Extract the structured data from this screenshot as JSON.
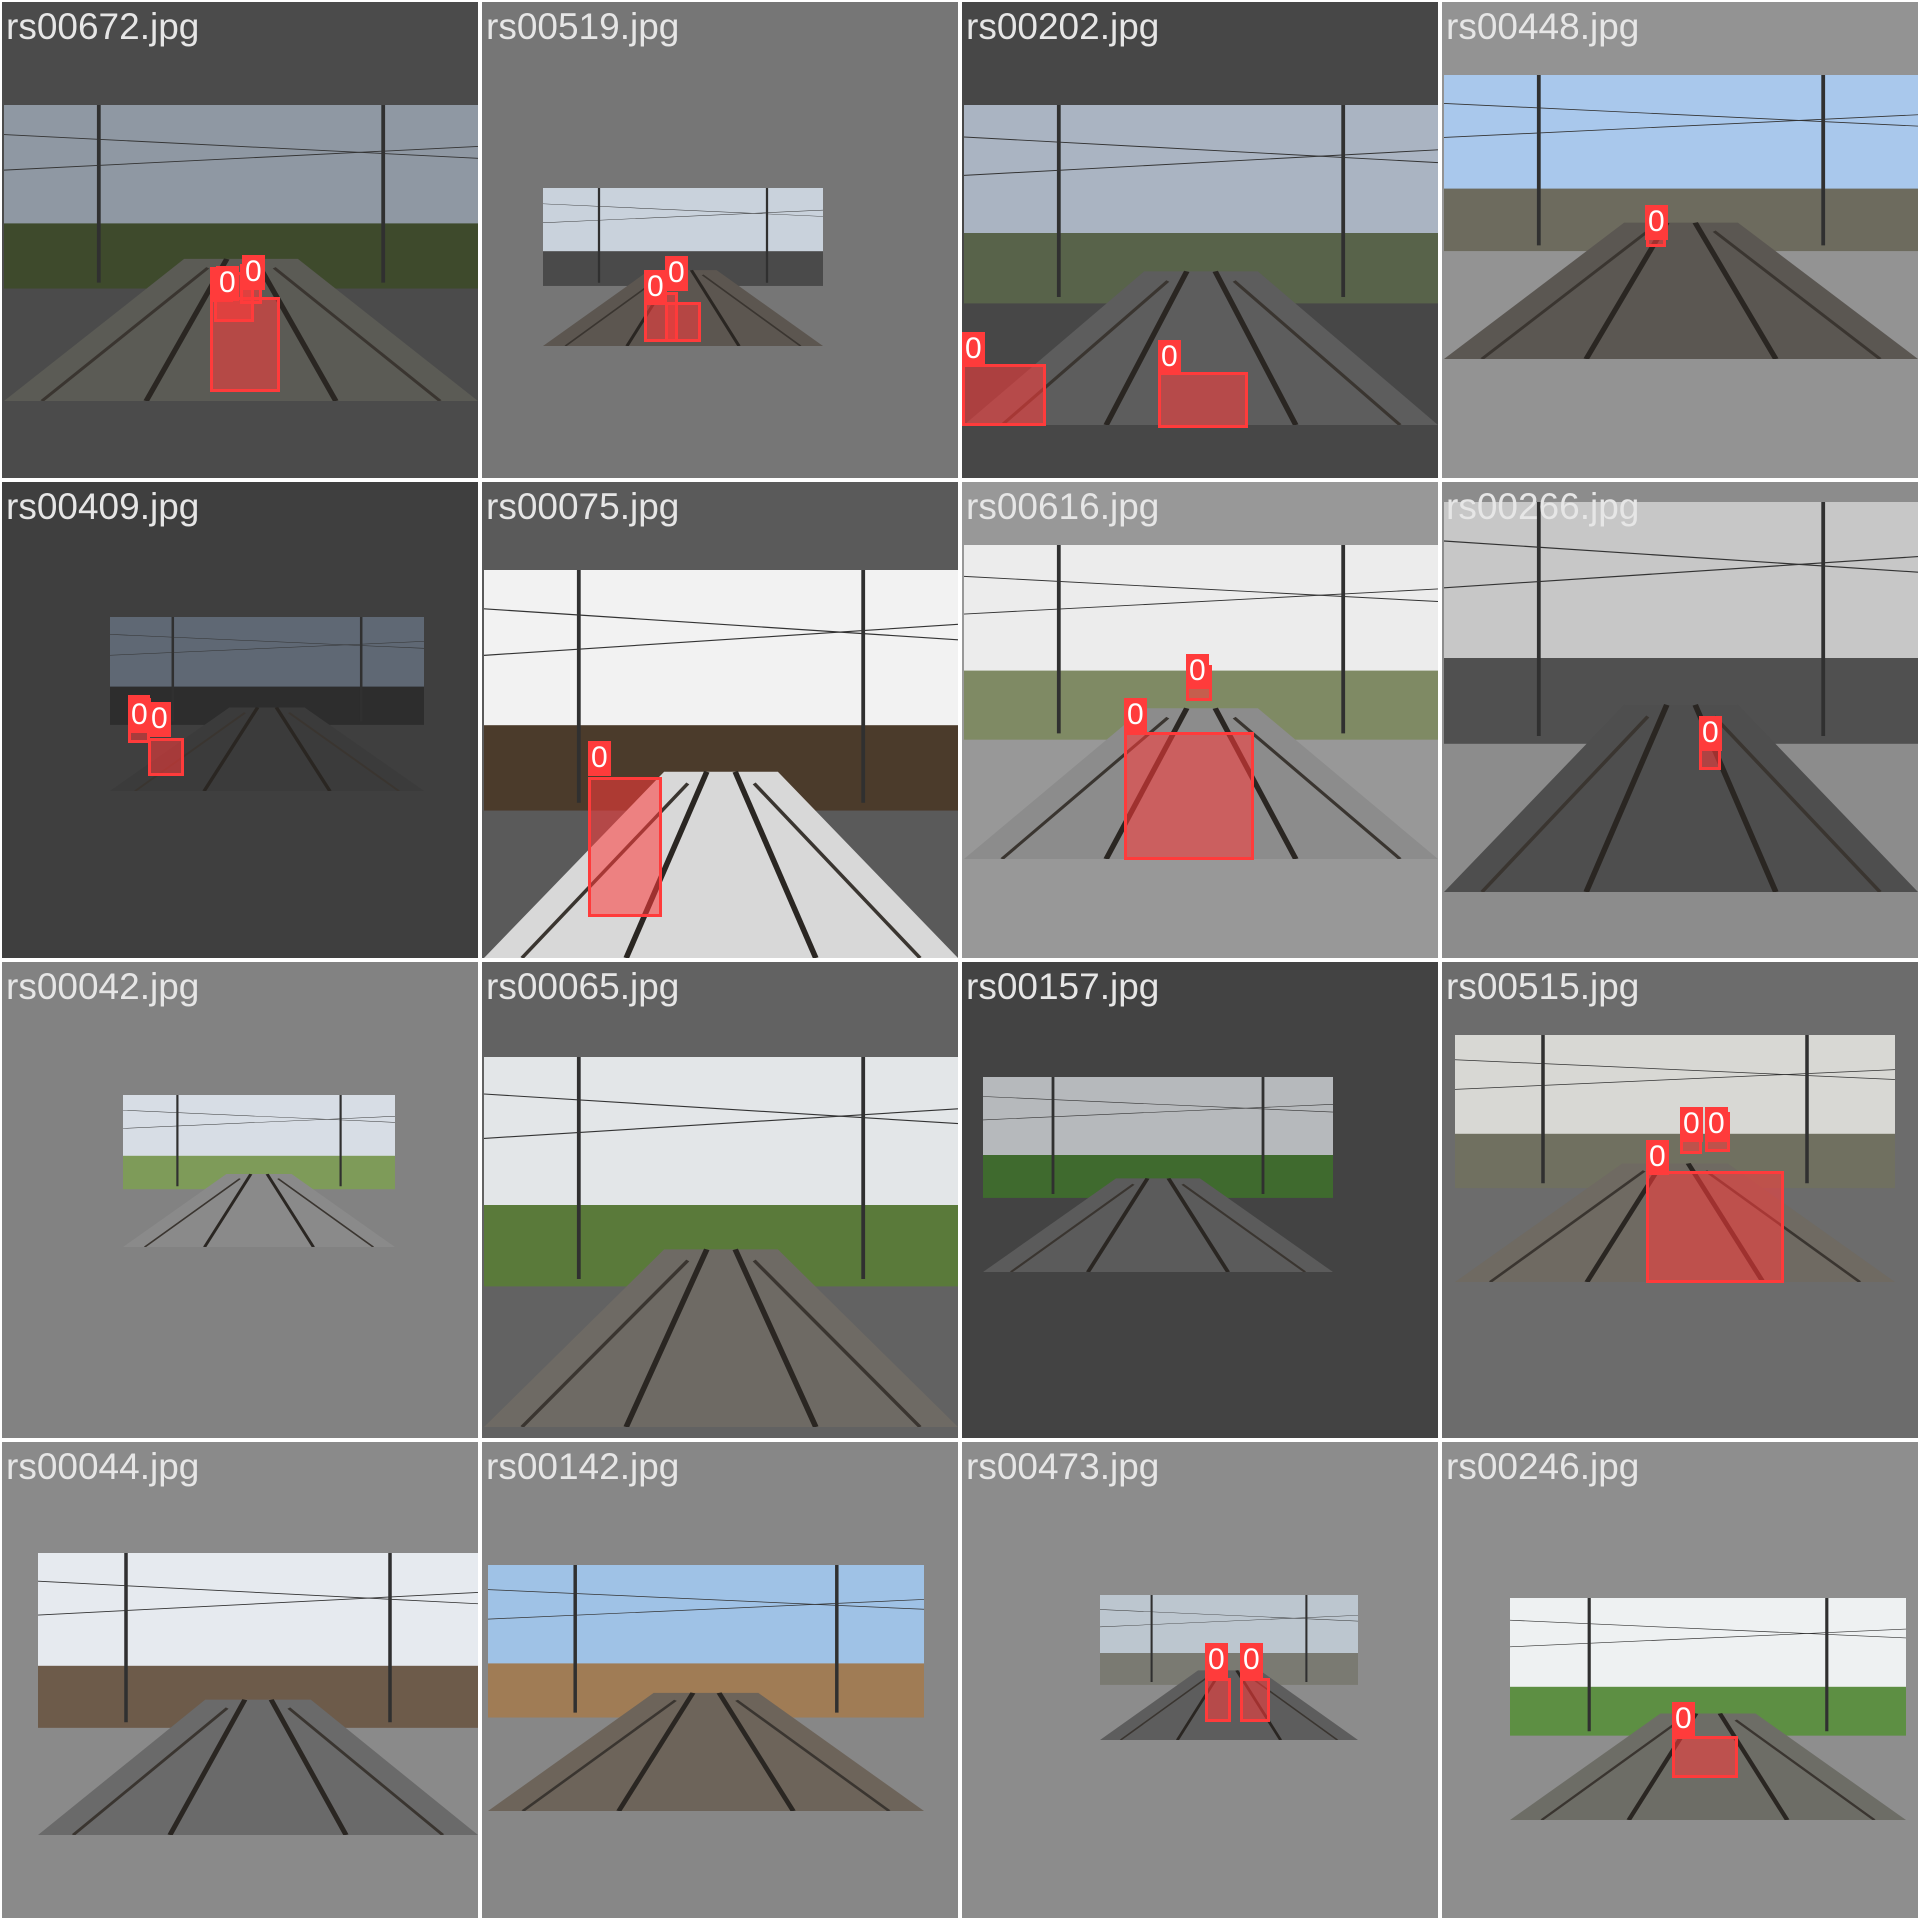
{
  "colors": {
    "detection": "#ff3b3b",
    "label_text": "#ffffff",
    "filename_text": "#e6e6e6"
  },
  "tiles": [
    {
      "filename": "rs00672.jpg",
      "bg": "#4b4b4b",
      "scene": "cloudy",
      "labels": [
        "0",
        "0",
        "0"
      ]
    },
    {
      "filename": "rs00519.jpg",
      "bg": "#767676",
      "scene": "yard",
      "labels": [
        "0",
        "0"
      ]
    },
    {
      "filename": "rs00202.jpg",
      "bg": "#474747",
      "scene": "town",
      "labels": [
        "0",
        "0"
      ]
    },
    {
      "filename": "rs00448.jpg",
      "bg": "#939393",
      "scene": "sunny",
      "labels": [
        "0"
      ]
    },
    {
      "filename": "rs00409.jpg",
      "bg": "#3f3f3f",
      "scene": "station",
      "labels": [
        "0",
        "0"
      ]
    },
    {
      "filename": "rs00075.jpg",
      "bg": "#5a5a5a",
      "scene": "snow",
      "labels": [
        "0"
      ]
    },
    {
      "filename": "rs00616.jpg",
      "bg": "#989898",
      "scene": "bridge",
      "labels": [
        "0",
        "0"
      ]
    },
    {
      "filename": "rs00266.jpg",
      "bg": "#8c8c8c",
      "scene": "dim",
      "labels": [
        "0"
      ]
    },
    {
      "filename": "rs00042.jpg",
      "bg": "#828282",
      "scene": "street",
      "labels": []
    },
    {
      "filename": "rs00065.jpg",
      "bg": "#626262",
      "scene": "forest",
      "labels": []
    },
    {
      "filename": "rs00157.jpg",
      "bg": "#434343",
      "scene": "signal",
      "labels": []
    },
    {
      "filename": "rs00515.jpg",
      "bg": "#6c6c6c",
      "scene": "overcast",
      "labels": [
        "0",
        "0",
        "0"
      ]
    },
    {
      "filename": "rs00044.jpg",
      "bg": "#8a8a8a",
      "scene": "platform",
      "labels": []
    },
    {
      "filename": "rs00142.jpg",
      "bg": "#878787",
      "scene": "field",
      "labels": []
    },
    {
      "filename": "rs00473.jpg",
      "bg": "#8c8c8c",
      "scene": "hall",
      "labels": [
        "0",
        "0"
      ]
    },
    {
      "filename": "rs00246.jpg",
      "bg": "#8e8e8e",
      "scene": "green",
      "labels": [
        "0"
      ]
    }
  ]
}
